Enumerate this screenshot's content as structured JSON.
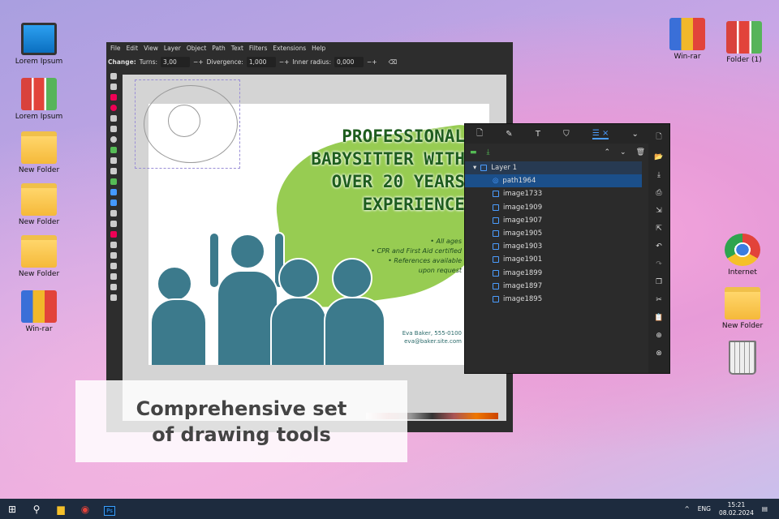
{
  "desktop": {
    "left": [
      {
        "label": "Lorem Ipsum",
        "icon": "computer"
      },
      {
        "label": "Lorem Ipsum",
        "icon": "binders"
      },
      {
        "label": "New Folder",
        "icon": "folder"
      },
      {
        "label": "New Folder",
        "icon": "folder"
      },
      {
        "label": "New Folder",
        "icon": "folder"
      },
      {
        "label": "Win-rar",
        "icon": "rar"
      }
    ],
    "right": [
      {
        "label": "Win-rar",
        "icon": "rar"
      },
      {
        "label": "Folder (1)",
        "icon": "binders"
      },
      {
        "label": "Internet",
        "icon": "chrome"
      },
      {
        "label": "New Folder",
        "icon": "folder"
      },
      {
        "label": "",
        "icon": "trash"
      }
    ]
  },
  "inkscape": {
    "menu": [
      "File",
      "Edit",
      "View",
      "Layer",
      "Object",
      "Path",
      "Text",
      "Filters",
      "Extensions",
      "Help"
    ],
    "toolbar": {
      "change": "Change:",
      "turns_label": "Turns:",
      "turns": "3,00",
      "divergence_label": "Divergence:",
      "divergence": "1,000",
      "inner_label": "Inner radius:",
      "inner": "0,000"
    },
    "flyer": {
      "headline": [
        "PROFESSIONAL",
        "BABYSITTER WITH",
        "OVER 20 YEARS",
        "EXPERIENCE"
      ],
      "bullets": [
        "• All ages",
        "• CPR and First Aid certified",
        "• References available",
        "upon request"
      ],
      "contact": [
        "Eva Baker, 555-0100",
        "eva@baker.site.com"
      ]
    }
  },
  "layers": {
    "layer": "Layer 1",
    "items": [
      "path1964",
      "image1733",
      "image1909",
      "image1907",
      "image1905",
      "image1903",
      "image1901",
      "image1899",
      "image1897",
      "image1895"
    ],
    "selected": "path1964"
  },
  "caption": [
    "Comprehensive set",
    "of drawing tools"
  ],
  "taskbar": {
    "lang": "ENG",
    "time": "15:21",
    "date": "08.02.2024"
  }
}
